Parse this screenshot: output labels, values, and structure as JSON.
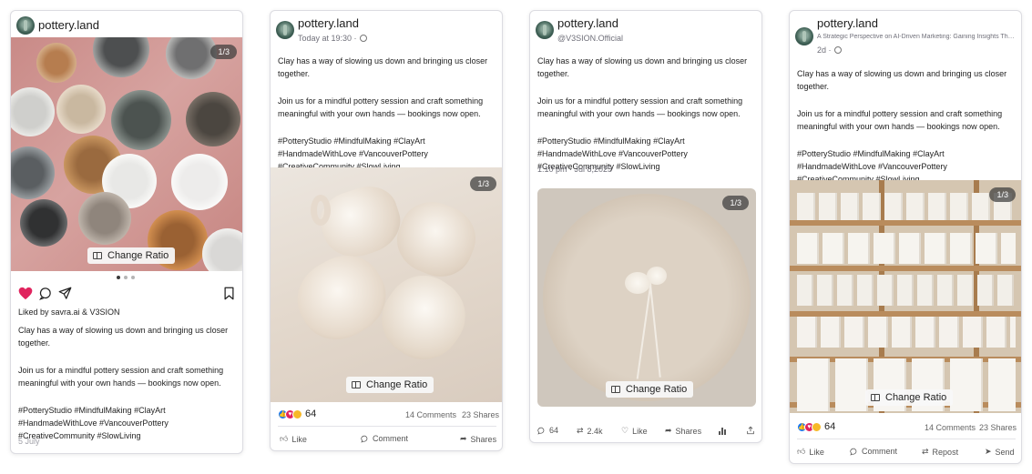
{
  "account": {
    "name": "pottery.land"
  },
  "caption": {
    "line1": "Clay has a way of slowing us down and bringing us closer together.",
    "line2": "Join us for a mindful pottery session and craft something meaningful with your own hands — bookings now open.",
    "tags": "#PotteryStudio #MindfulMaking #ClayArt #HandmadeWithLove #VancouverPottery #CreativeCommunity #SlowLiving"
  },
  "media": {
    "counter": "1/3",
    "change_ratio_label": "Change Ratio"
  },
  "colors": {
    "like_red": "#e0245e",
    "accent_blue": "#1877f2"
  },
  "instagram": {
    "liked_by": "Liked by savra.ai & V3SION",
    "date": "5 July",
    "dots": 3,
    "active_dot": 0
  },
  "facebook": {
    "time": "Today at 19:30 ·",
    "reaction_count": "64",
    "comments": "14 Comments",
    "shares": "23 Shares",
    "actions": {
      "like": "Like",
      "comment": "Comment",
      "share": "Shares"
    }
  },
  "twitter": {
    "handle": "@V3SION.Official",
    "timestamp": "1:10 pm · Jul 8,2025",
    "replies": "64",
    "retweets": "2.4k",
    "likes": "Like",
    "shares": "Shares"
  },
  "linkedin": {
    "headline": "A Strategic Perspective on AI-Driven Marketing: Gaining Insights Tha...",
    "time": "2d ·",
    "reaction_count": "64",
    "comments": "14 Comments",
    "shares": "23 Shares",
    "actions": {
      "like": "Like",
      "comment": "Comment",
      "repost": "Repost",
      "send": "Send"
    }
  }
}
